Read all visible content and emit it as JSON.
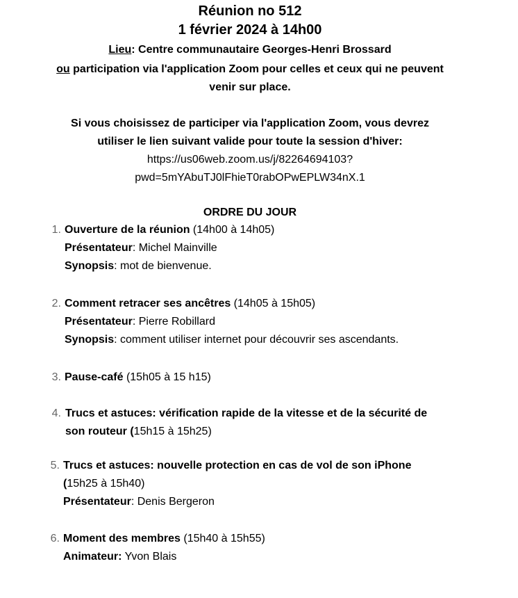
{
  "header": {
    "title": "Réunion no 512",
    "date": "1 février 2024 à 14h00",
    "lieu_label": "Lieu",
    "lieu_value": ": Centre communautaire Georges-Henri Brossard",
    "ou": "ou",
    "zoom_line1": " participation via l'application Zoom pour celles et ceux qui ne peuvent",
    "zoom_line2": "venir sur place."
  },
  "zoom_info": {
    "line1": "Si vous choisissez de participer via l'application Zoom,  vous devrez",
    "line2": "utiliser le lien suivant valide pour toute la session d'hiver:",
    "link1": "https://us06web.zoom.us/j/82264694103?",
    "link2": "pwd=5mYAbuTJ0lFhieT0rabOPwEPLW34nX.1"
  },
  "agenda": {
    "heading": "ORDRE DU JOUR",
    "items": [
      {
        "num": "1.",
        "title": "Ouverture de la réunion",
        "time": " (14h00 à 14h05)",
        "presenter_label": "Présentateur",
        "presenter": ": Michel Mainville",
        "synopsis_label": "Synopsis",
        "synopsis": ": mot de bienvenue."
      },
      {
        "num": "2.",
        "title": "Comment retracer ses ancêtres",
        "time": " (14h05 à 15h05)",
        "presenter_label": "Présentateur",
        "presenter": ": Pierre Robillard",
        "synopsis_label": "Synopsis",
        "synopsis": ": comment utiliser internet pour découvrir ses ascendants."
      },
      {
        "num": "3.",
        "title": "Pause-café",
        "time": " (15h05 à 15 h15)"
      },
      {
        "num": "4.",
        "title_line1": "Trucs et astuces: vérification rapide de la vitesse et de la sécurité de",
        "title_line2": "son routeur (",
        "time": "15h15 à 15h25)"
      },
      {
        "num": "5.",
        "title_line1": "Trucs et astuces: nouvelle protection en cas de vol de son iPhone",
        "title_line2": "(",
        "time": "15h25 à 15h40)",
        "presenter_label": "Présentateur",
        "presenter": ": Denis Bergeron"
      },
      {
        "num": "6.",
        "title": "Moment des membres",
        "time": " (15h40 à 15h55)",
        "animator_label": "Animateur:",
        "animator": " Yvon Blais"
      }
    ]
  }
}
